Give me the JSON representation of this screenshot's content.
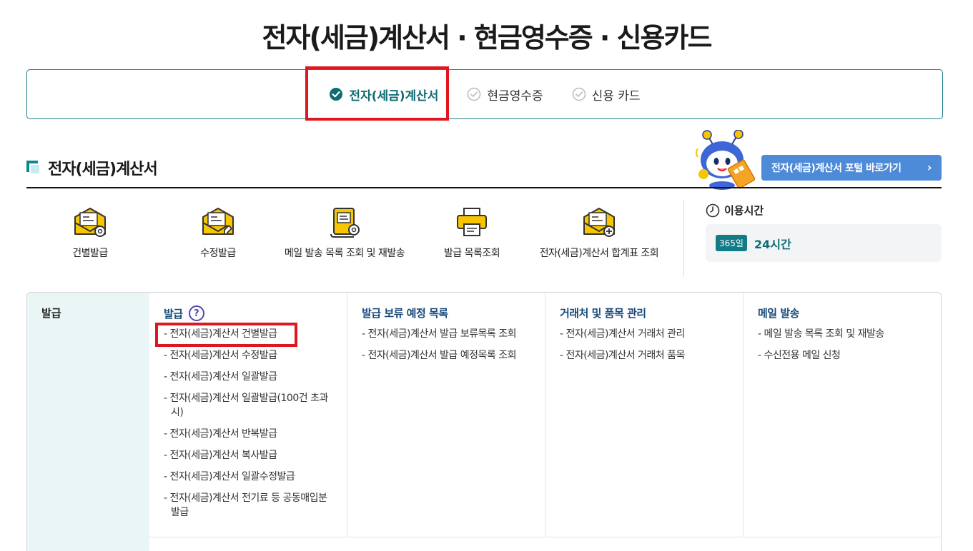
{
  "page": {
    "title": "전자(세금)계산서 · 현금영수증 · 신용카드"
  },
  "tabs": [
    {
      "label": "전자(세금)계산서",
      "active": true
    },
    {
      "label": "현금영수증",
      "active": false
    },
    {
      "label": "신용 카드",
      "active": false
    }
  ],
  "section": {
    "title": "전자(세금)계산서",
    "portal_button": "전자(세금)계산서 포털 바로가기"
  },
  "quick_links": [
    {
      "label": "건별발급",
      "icon": "envelope-gear-icon"
    },
    {
      "label": "수정발급",
      "icon": "envelope-edit-icon"
    },
    {
      "label": "메일 발송 목록 조회 및 재발송",
      "icon": "scroll-mail-icon"
    },
    {
      "label": "발급 목록조회",
      "icon": "printer-icon"
    },
    {
      "label": "전자(세금)계산서 합계표 조회",
      "icon": "envelope-plus-icon"
    }
  ],
  "hours": {
    "title": "이용시간",
    "badge": "365일",
    "value": "24시간"
  },
  "menu": {
    "side_label": "발급",
    "columns": [
      {
        "title": "발급",
        "help": "?",
        "items": [
          "- 전자(세금)계산서 건별발급",
          "- 전자(세금)계산서 수정발급",
          "- 전자(세금)계산서 일괄발급",
          "- 전자(세금)계산서 일괄발급(100건 초과 시)",
          "- 전자(세금)계산서 반복발급",
          "- 전자(세금)계산서 복사발급",
          "- 전자(세금)계산서 일괄수정발급",
          "- 전자(세금)계산서 전기료 등 공동매입분 발급"
        ]
      },
      {
        "title": "발급 보류 예정 목록",
        "items": [
          "- 전자(세금)계산서 발급 보류목록 조회",
          "- 전자(세금)계산서 발급 예정목록 조회"
        ]
      },
      {
        "title": "거래처 및 품목 관리",
        "items": [
          "- 전자(세금)계산서 거래처 관리",
          "- 전자(세금)계산서 거래처 품목"
        ]
      },
      {
        "title": "메일 발송",
        "items": [
          "- 메일 발송 목록 조회 및 재발송",
          "- 수신전용 메일 신청"
        ]
      }
    ]
  },
  "colors": {
    "accent": "#106b72",
    "highlight": "#e0161f",
    "portal_button": "#4d8ad8",
    "menu_title": "#17497a"
  }
}
